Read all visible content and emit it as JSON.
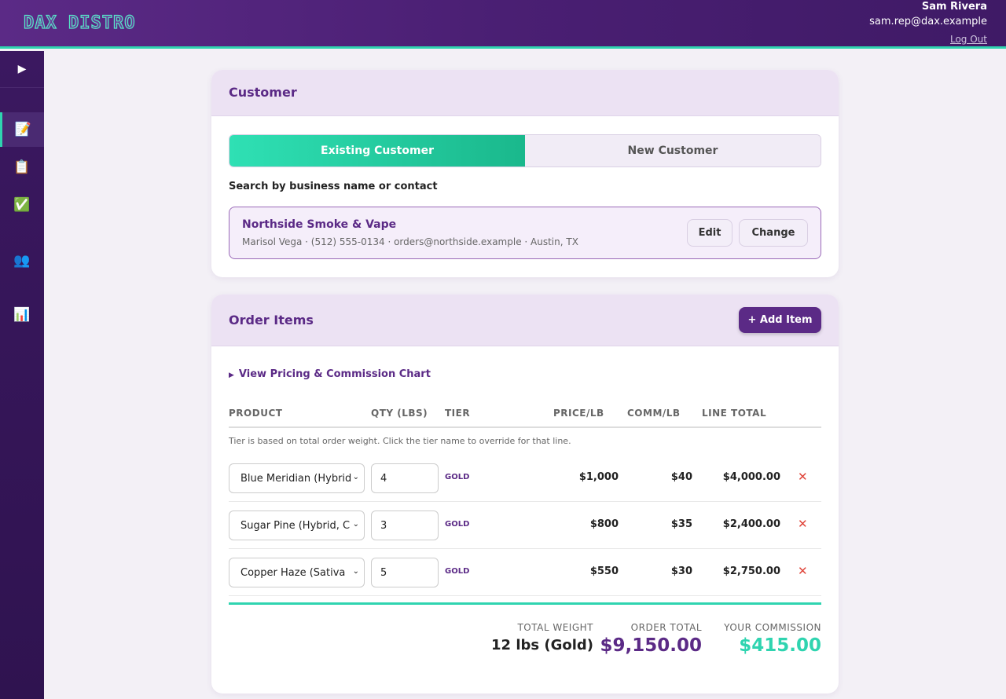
{
  "header": {
    "logo": "DAX DISTRO",
    "user_name": "Sam Rivera",
    "user_email": "sam.rep@dax.example",
    "logout": "Log Out"
  },
  "sidebar": {
    "toggle_icon": "play-icon",
    "items": [
      {
        "icon": "memo-icon",
        "glyph": "📝",
        "active": true
      },
      {
        "icon": "clipboard-icon",
        "glyph": "📋",
        "active": false
      },
      {
        "icon": "check-icon",
        "glyph": "✅",
        "active": false
      },
      {
        "icon": "users-icon",
        "glyph": "👥",
        "active": false
      },
      {
        "icon": "bar-chart-icon",
        "glyph": "📊",
        "active": false
      }
    ]
  },
  "customer": {
    "title": "Customer",
    "tab_existing": "Existing Customer",
    "tab_new": "New Customer",
    "search_label": "Search by business name or contact",
    "selected_name": "Northside Smoke & Vape",
    "selected_details": "Marisol Vega · (512) 555-0134 · orders@northside.example · Austin, TX",
    "edit": "Edit",
    "change": "Change"
  },
  "items": {
    "title": "Order Items",
    "add": "+ Add Item",
    "chart_link": "View Pricing & Commission Chart",
    "columns": {
      "product": "PRODUCT",
      "qty": "QTY (LBS)",
      "tier": "TIER",
      "price": "PRICE/LB",
      "comm": "COMM/LB",
      "line": "LINE TOTAL"
    },
    "note": "Tier is based on total order weight. Click the tier name to override for that line.",
    "rows": [
      {
        "product": "Blue Meridian (Hybrid",
        "qty": "4",
        "tier": "GOLD",
        "price": "$1,000",
        "comm": "$40",
        "line": "$4,000.00"
      },
      {
        "product": "Sugar Pine (Hybrid, C",
        "qty": "3",
        "tier": "GOLD",
        "price": "$800",
        "comm": "$35",
        "line": "$2,400.00"
      },
      {
        "product": "Copper Haze (Sativa",
        "qty": "5",
        "tier": "GOLD",
        "price": "$550",
        "comm": "$30",
        "line": "$2,750.00"
      }
    ],
    "delete_glyph": "✕"
  },
  "totals": {
    "weight_label": "TOTAL WEIGHT",
    "weight_value": "12 lbs (Gold)",
    "order_label": "ORDER TOTAL",
    "order_value": "$9,150.00",
    "commission_label": "YOUR COMMISSION",
    "commission_value": "$415.00"
  },
  "colors": {
    "brand": "#5b2a86",
    "accent": "#2fd4b0",
    "danger": "#e0453a"
  }
}
